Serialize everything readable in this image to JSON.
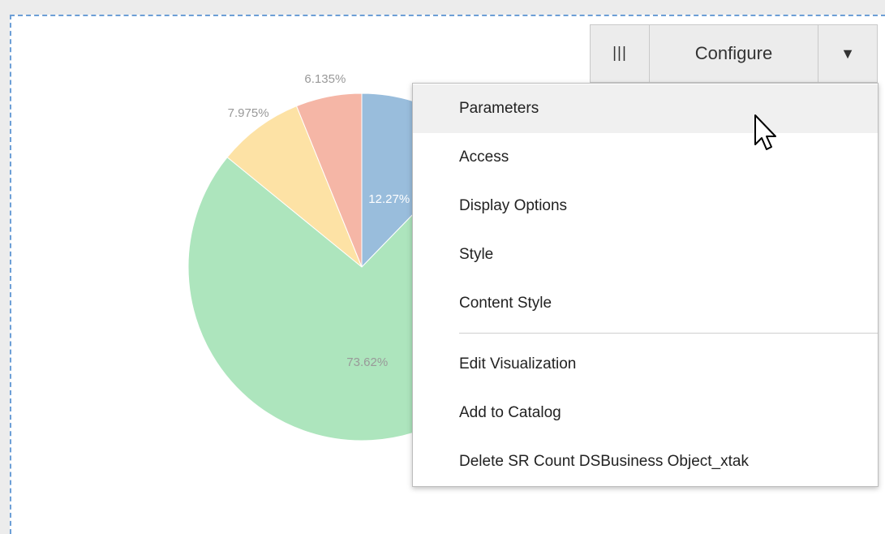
{
  "toolbar": {
    "columns_icon": "|||",
    "configure_label": "Configure",
    "dropdown_icon": "▼"
  },
  "menu": {
    "items": [
      {
        "label": "Parameters"
      },
      {
        "label": "Access"
      },
      {
        "label": "Display Options"
      },
      {
        "label": "Style"
      },
      {
        "label": "Content Style"
      },
      {
        "label": "Edit Visualization"
      },
      {
        "label": "Add to Catalog"
      },
      {
        "label": "Delete SR Count DSBusiness Object_xtak"
      }
    ],
    "hovered_item": "Parameters"
  },
  "chart_data": {
    "type": "pie",
    "slices": [
      {
        "label": "12.27%",
        "value": 12.27,
        "color": "#99bddc"
      },
      {
        "label": "73.62%",
        "value": 73.62,
        "color": "#ade5bd"
      },
      {
        "label": "7.975%",
        "value": 7.975,
        "color": "#fde2a5"
      },
      {
        "label": "6.135%",
        "value": 6.135,
        "color": "#f5b6a6"
      }
    ]
  },
  "colors": {
    "frame_border": "#6d9fd6",
    "menu_hover": "#f0f0f0"
  }
}
